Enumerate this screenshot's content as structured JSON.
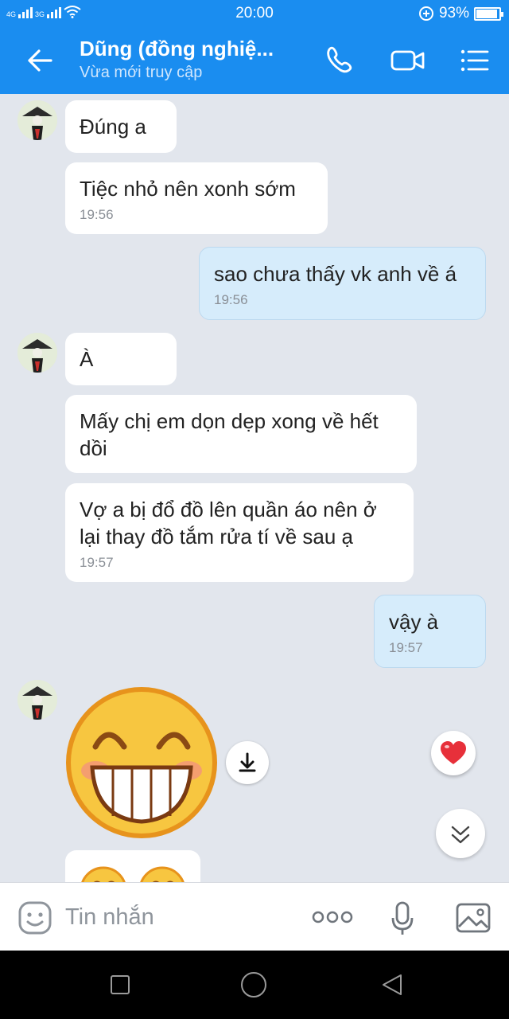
{
  "status_bar": {
    "network_1": "4G",
    "network_2": "3G",
    "time": "20:00",
    "battery": "93%",
    "battery_level": 0.93,
    "icons": [
      "signal-icon",
      "wifi-icon",
      "data-saver-icon",
      "battery-icon"
    ]
  },
  "header": {
    "contact_name": "Dũng (đồng nghiệ...",
    "status": "Vừa mới truy cập",
    "icons": [
      "back-arrow-icon",
      "phone-icon",
      "video-call-icon",
      "menu-list-icon"
    ],
    "color": "#1a8df0"
  },
  "messages": [
    {
      "dir": "in",
      "text": "Đúng a"
    },
    {
      "dir": "in",
      "text": "Tiệc nhỏ nên xonh sớm",
      "time": "19:56"
    },
    {
      "dir": "out",
      "text": "sao chưa thấy vk anh về á",
      "time": "19:56"
    },
    {
      "dir": "in",
      "text": "À"
    },
    {
      "dir": "in",
      "text": "Mấy chị em dọn dẹp xong về hết dồi"
    },
    {
      "dir": "in",
      "text": "Vợ a bị đổ đồ lên quần áo nên ở lại thay đồ tắm rửa tí về sau ạ",
      "time": "19:57"
    },
    {
      "dir": "out",
      "text": "vậy à",
      "time": "19:57"
    },
    {
      "dir": "in",
      "type": "sticker",
      "sticker": "grinning-face-sticker"
    },
    {
      "dir": "in",
      "type": "sticker-partial",
      "sticker": "smiling-faces-sticker"
    }
  ],
  "actions": {
    "download": "download-icon",
    "reaction": "heart-icon",
    "scroll": "chevron-double-down-icon"
  },
  "input": {
    "placeholder": "Tin nhắn",
    "icons": [
      "emoji-icon",
      "more-dots-icon",
      "microphone-icon",
      "image-icon"
    ]
  },
  "nav": {
    "icons": [
      "recent-apps-icon",
      "home-icon",
      "back-triangle-icon"
    ]
  }
}
